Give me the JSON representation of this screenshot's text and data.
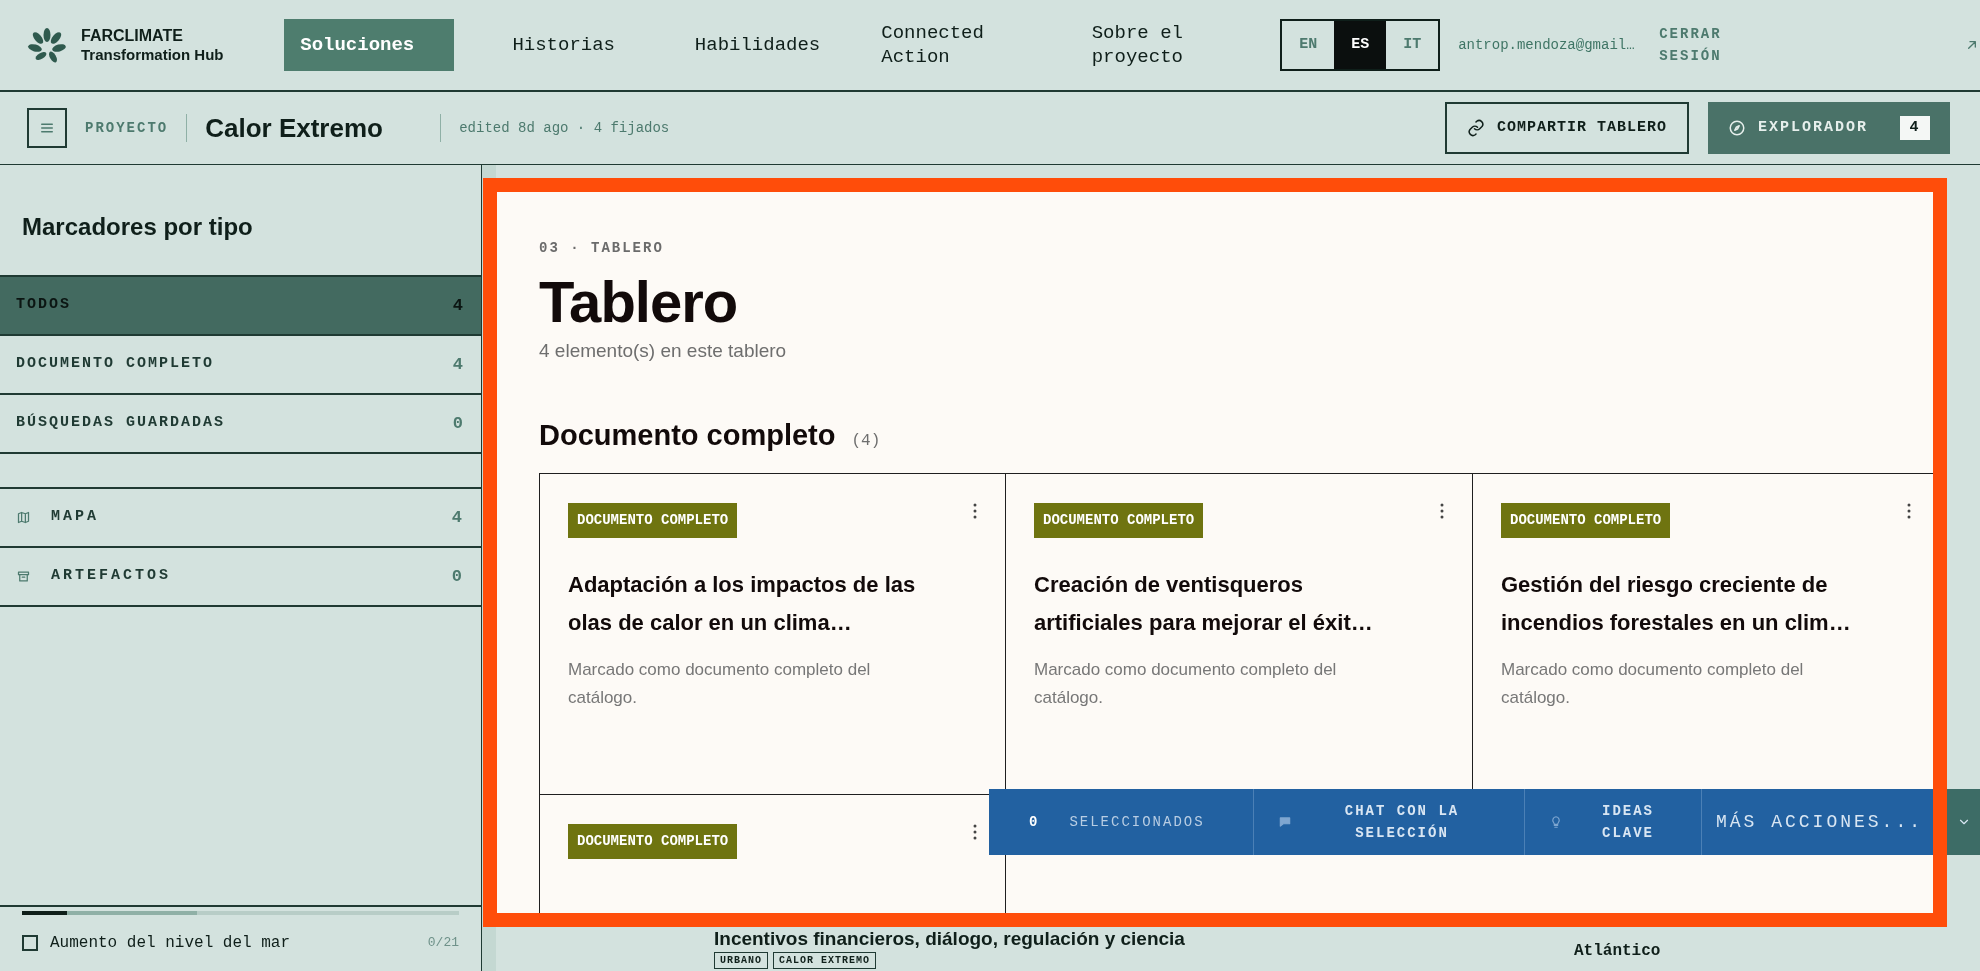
{
  "brand": {
    "line_1": "FARCLIMATE",
    "line_2": "Transformation Hub"
  },
  "nav": [
    {
      "label": "Soluciones",
      "selected": true
    },
    {
      "label": "Historias",
      "selected": false
    },
    {
      "label": "Habilidades",
      "selected": false
    },
    {
      "label": "Connected Action",
      "selected": false
    },
    {
      "label": "Sobre el proyecto",
      "selected": false
    }
  ],
  "languages": [
    {
      "label": "EN",
      "selected": false
    },
    {
      "label": "ES",
      "selected": true
    },
    {
      "label": "IT",
      "selected": false
    }
  ],
  "user_email": "antrop.mendoza@gmail…",
  "logout": "CERRAR SESIÓN",
  "project_bar": {
    "section": "PROYECTO",
    "title": "Calor Extremo",
    "meta": "edited 8d ago · 4 fijados",
    "share_button": "COMPARTIR TABLERO",
    "explorer_button": {
      "label": "EXPLORADOR",
      "count": "4"
    }
  },
  "sidebar": {
    "title": "Marcadores por tipo",
    "filters": [
      {
        "label": "TODOS",
        "count": "4",
        "selected": true
      },
      {
        "label": "DOCUMENTO COMPLETO",
        "count": "4",
        "selected": false
      },
      {
        "label": "BÚSQUEDAS GUARDADAS",
        "count": "0",
        "selected": false
      }
    ],
    "views": [
      {
        "label": "MAPA",
        "count": "4",
        "kind": "map"
      },
      {
        "label": "ARTEFACTOS",
        "count": "0",
        "kind": "archive"
      }
    ],
    "layer_item": {
      "label": "Aumento del nivel del mar",
      "count": "0/21",
      "checked": false
    }
  },
  "background": {
    "title_fragment": "Incentivos financieros, diálogo, regulación y ciencia",
    "tags": [
      "URBANO",
      "CALOR EXTREMO"
    ],
    "region": "Atlántico"
  },
  "board": {
    "eyebrow": "03 · TABLERO",
    "title": "Tablero",
    "subtitle": "4 elemento(s) en este tablero",
    "group": {
      "title": "Documento completo",
      "count": "(4)",
      "cards": [
        {
          "tag": "DOCUMENTO COMPLETO",
          "title": "Adaptación a los impactos de las olas de calor en un clima…",
          "description": "Marcado como documento completo del catálogo."
        },
        {
          "tag": "DOCUMENTO COMPLETO",
          "title": "Creación de ventisqueros artificiales para mejorar el éxit…",
          "description": "Marcado como documento completo del catálogo."
        },
        {
          "tag": "DOCUMENTO COMPLETO",
          "title": "Gestión del riesgo creciente de incendios forestales en un clim…",
          "description": "Marcado como documento completo del catálogo."
        },
        {
          "tag": "DOCUMENTO COMPLETO"
        }
      ]
    }
  },
  "selection_bar": {
    "count": "0",
    "label": "SELECCIONADOS",
    "chat": "CHAT CON LA SELECCIÓN",
    "ideas": "IDEAS CLAVE",
    "more": "MÁS ACCIONES..."
  }
}
